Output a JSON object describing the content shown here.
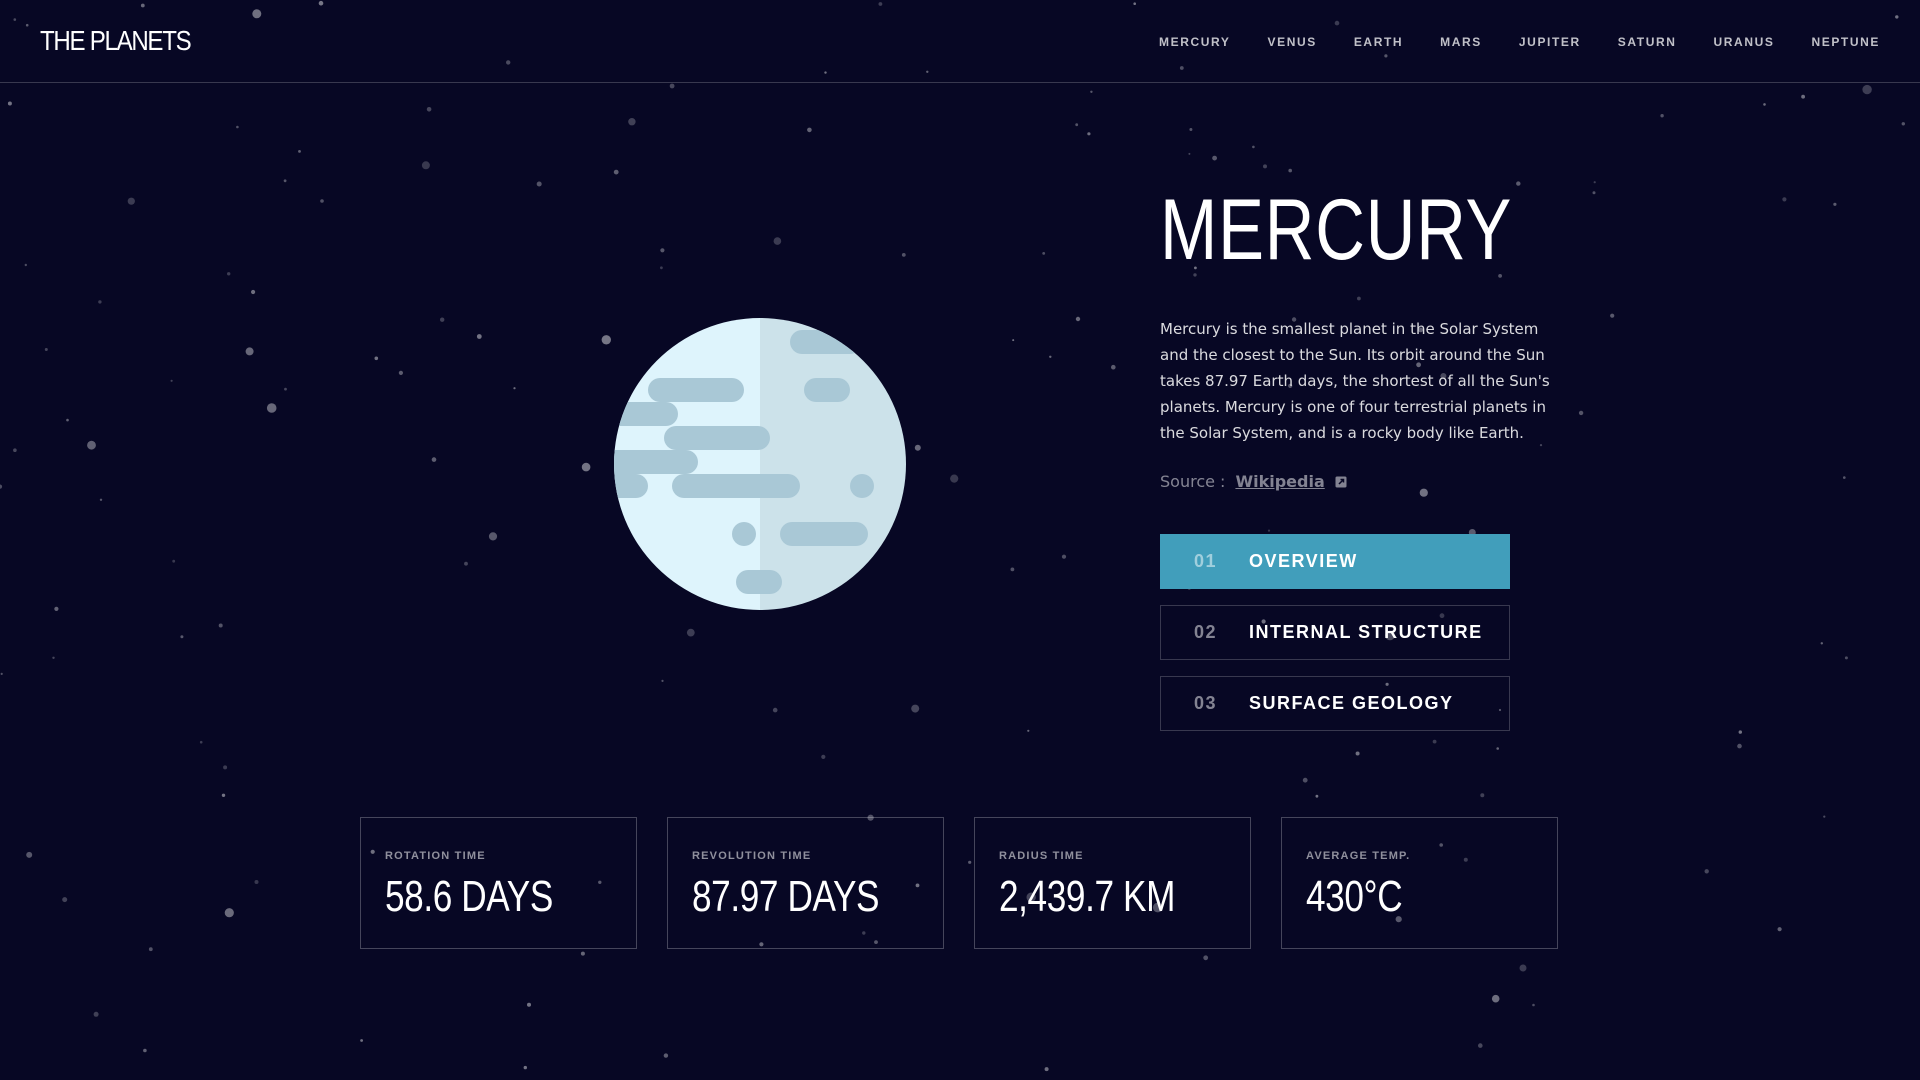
{
  "app": {
    "logo": "THE PLANETS"
  },
  "nav": {
    "items": [
      {
        "label": "MERCURY"
      },
      {
        "label": "VENUS"
      },
      {
        "label": "EARTH"
      },
      {
        "label": "MARS"
      },
      {
        "label": "JUPITER"
      },
      {
        "label": "SATURN"
      },
      {
        "label": "URANUS"
      },
      {
        "label": "NEPTUNE"
      }
    ]
  },
  "planet": {
    "name": "MERCURY",
    "description": "Mercury is the smallest planet in the Solar System and the closest to the Sun. Its orbit around the Sun takes 87.97 Earth days, the shortest of all the Sun's planets. Mercury is one of four terrestrial planets in the Solar System, and is a rocky body like Earth.",
    "source_label": "Source :",
    "source_link": "Wikipedia"
  },
  "tabs": [
    {
      "num": "01",
      "label": "OVERVIEW",
      "active": true
    },
    {
      "num": "02",
      "label": "INTERNAL STRUCTURE",
      "active": false
    },
    {
      "num": "03",
      "label": "SURFACE GEOLOGY",
      "active": false
    }
  ],
  "stats": [
    {
      "label": "ROTATION TIME",
      "value": "58.6 DAYS"
    },
    {
      "label": "REVOLUTION TIME",
      "value": "87.97 DAYS"
    },
    {
      "label": "RADIUS TIME",
      "value": "2,439.7 KM"
    },
    {
      "label": "AVERAGE TEMP.",
      "value": "430°C"
    }
  ],
  "colors": {
    "background": "#070724",
    "accent": "#419EBB",
    "planet_light": "#DEF4FC",
    "planet_shade": "#CCE2EA",
    "planet_crater": "#A9C8D6"
  },
  "icons": {
    "external_link": "external-link-icon"
  }
}
